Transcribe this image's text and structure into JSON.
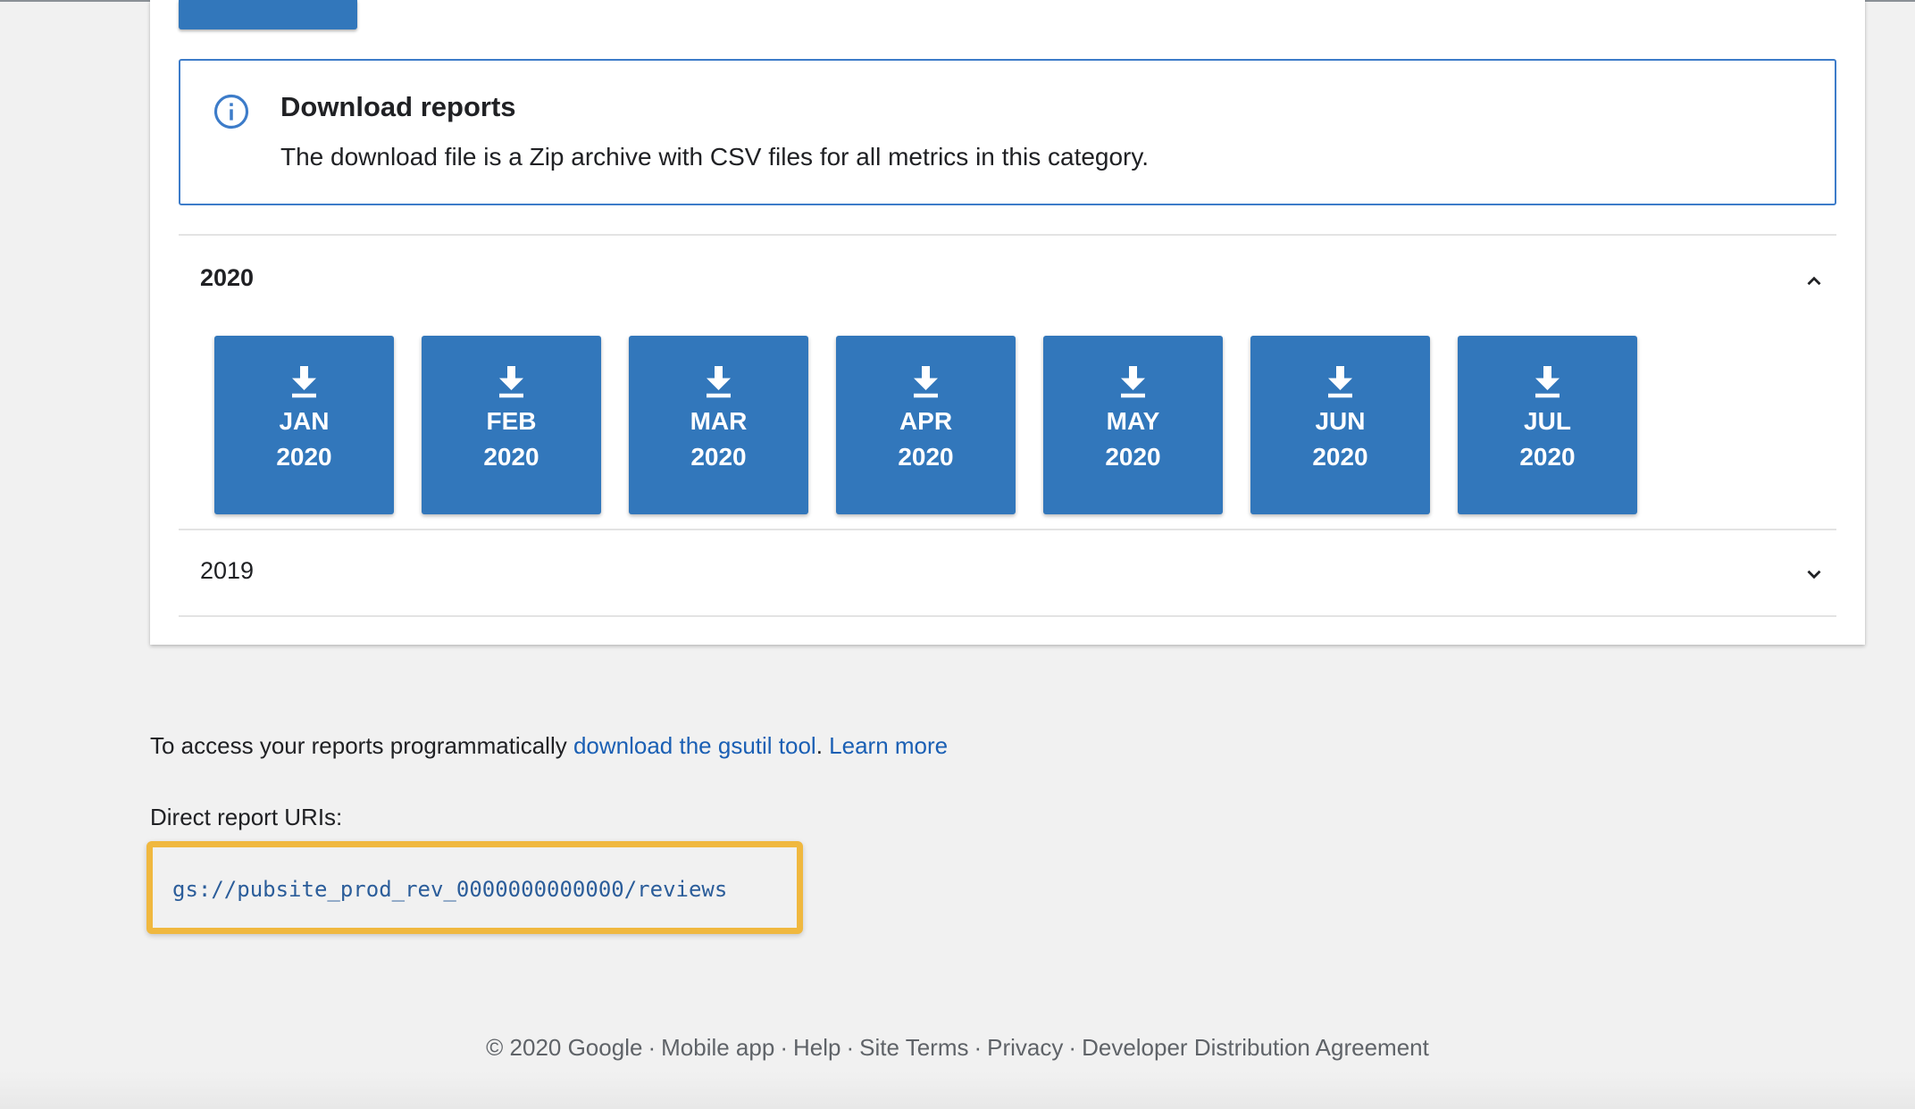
{
  "info": {
    "title": "Download reports",
    "text": "The download file is a Zip archive with CSV files for all metrics in this category."
  },
  "years": [
    {
      "label": "2020",
      "expanded": true
    },
    {
      "label": "2019",
      "expanded": false
    }
  ],
  "months": [
    {
      "month": "JAN",
      "year": "2020"
    },
    {
      "month": "FEB",
      "year": "2020"
    },
    {
      "month": "MAR",
      "year": "2020"
    },
    {
      "month": "APR",
      "year": "2020"
    },
    {
      "month": "MAY",
      "year": "2020"
    },
    {
      "month": "JUN",
      "year": "2020"
    },
    {
      "month": "JUL",
      "year": "2020"
    }
  ],
  "access": {
    "prefix": "To access your reports programmatically ",
    "link1": "download the gsutil tool",
    "sep": ". ",
    "link2": "Learn more"
  },
  "uris": {
    "label": "Direct report URIs:",
    "value": "gs://pubsite_prod_rev_0000000000000/reviews"
  },
  "footer": {
    "copyright": "© 2020 Google",
    "links": [
      "Mobile app",
      "Help",
      "Site Terms",
      "Privacy",
      "Developer Distribution Agreement"
    ]
  },
  "colors": {
    "primary": "#3277bb",
    "link": "#1a5fb4",
    "highlight": "#f0b83f",
    "info_border": "#3d7cc9"
  },
  "icons": [
    "info-icon",
    "download-icon",
    "chevron-up-icon",
    "chevron-down-icon"
  ]
}
